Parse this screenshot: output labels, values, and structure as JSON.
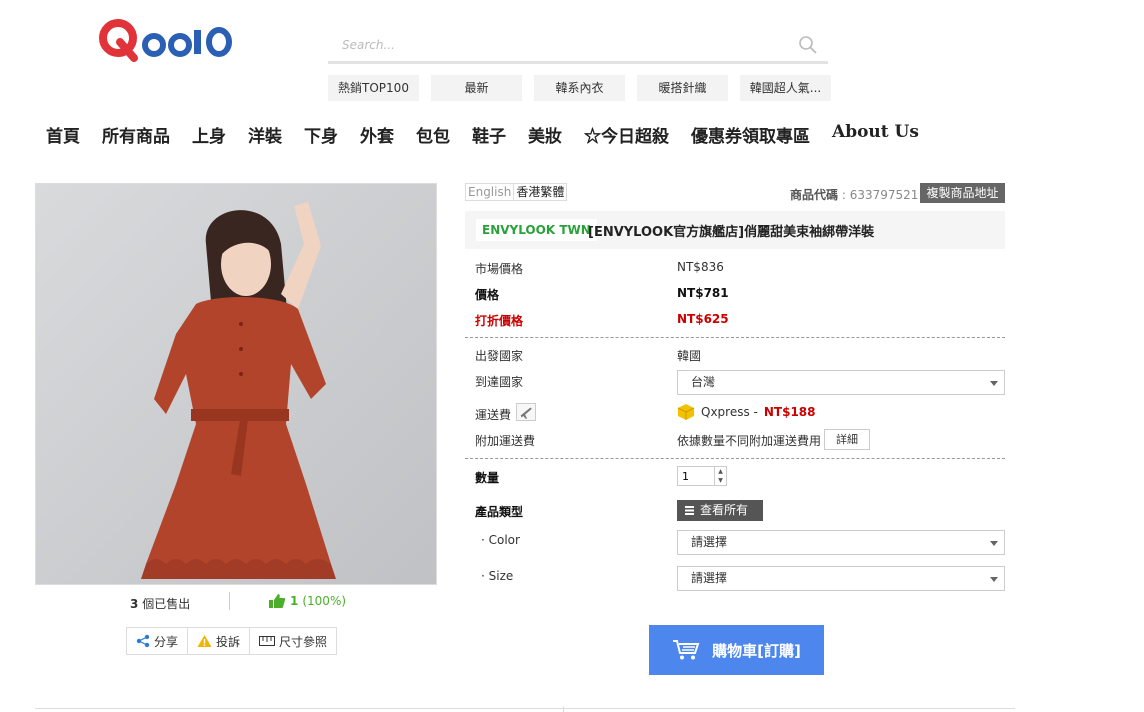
{
  "brand": {
    "logo_text": "Qoo10",
    "colors": {
      "logo_q": "#e0343a",
      "logo_rest": "#2b5fb4",
      "accent": "#4d87ee",
      "price_red": "#cc0000",
      "shop_green": "#2aa13a"
    }
  },
  "search": {
    "placeholder": "Search...",
    "icon": "search-icon"
  },
  "keywords": [
    "熱銷TOP100",
    "最新",
    "韓系內衣",
    "暖搭針織",
    "韓國超人氣..."
  ],
  "nav": [
    "首頁",
    "所有商品",
    "上身",
    "洋裝",
    "下身",
    "外套",
    "包包",
    "鞋子",
    "美妝",
    "☆今日超殺",
    "優惠券領取專區",
    "About Us"
  ],
  "gallery": {
    "sold_count": "3",
    "sold_label": "個已售出",
    "like_count": "1",
    "like_percent": "(100%)",
    "actions": [
      {
        "label": "分享",
        "icon": "share-icon"
      },
      {
        "label": "投訴",
        "icon": "warning-icon"
      },
      {
        "label": "尺寸參照",
        "icon": "ruler-icon"
      }
    ]
  },
  "language": {
    "english": "English",
    "chinese": "香港繁體"
  },
  "product_code": {
    "label": "商品代碼",
    "value": ": 633797521"
  },
  "copy_link_label": "複製商品地址",
  "shop_name": "ENVYLOOK TWN",
  "product_title": "[ENVYLOOK官方旗艦店]俏麗甜美束袖綁帶洋裝",
  "prices": {
    "market_label": "市場價格",
    "market_value": "NT$836",
    "price_label": "價格",
    "price_value": "NT$781",
    "discount_label": "打折價格",
    "discount_value": "NT$625"
  },
  "shipping": {
    "origin_label": "出發國家",
    "origin_value": "韓國",
    "dest_label": "到達國家",
    "dest_value": "台灣",
    "fee_label": "運送費",
    "carrier": "Qxpress -",
    "fee_value": "NT$188",
    "extra_label": "附加運送費",
    "extra_value": "依據數量不同附加運送費用",
    "detail_label": "詳細"
  },
  "options": {
    "qty_label": "數量",
    "qty_value": "1",
    "type_label": "產品類型",
    "view_all_label": "查看所有",
    "color_label": "· Color",
    "color_value": "請選擇",
    "size_label": "· Size",
    "size_value": "請選擇"
  },
  "cart_label": "購物車[訂購]"
}
